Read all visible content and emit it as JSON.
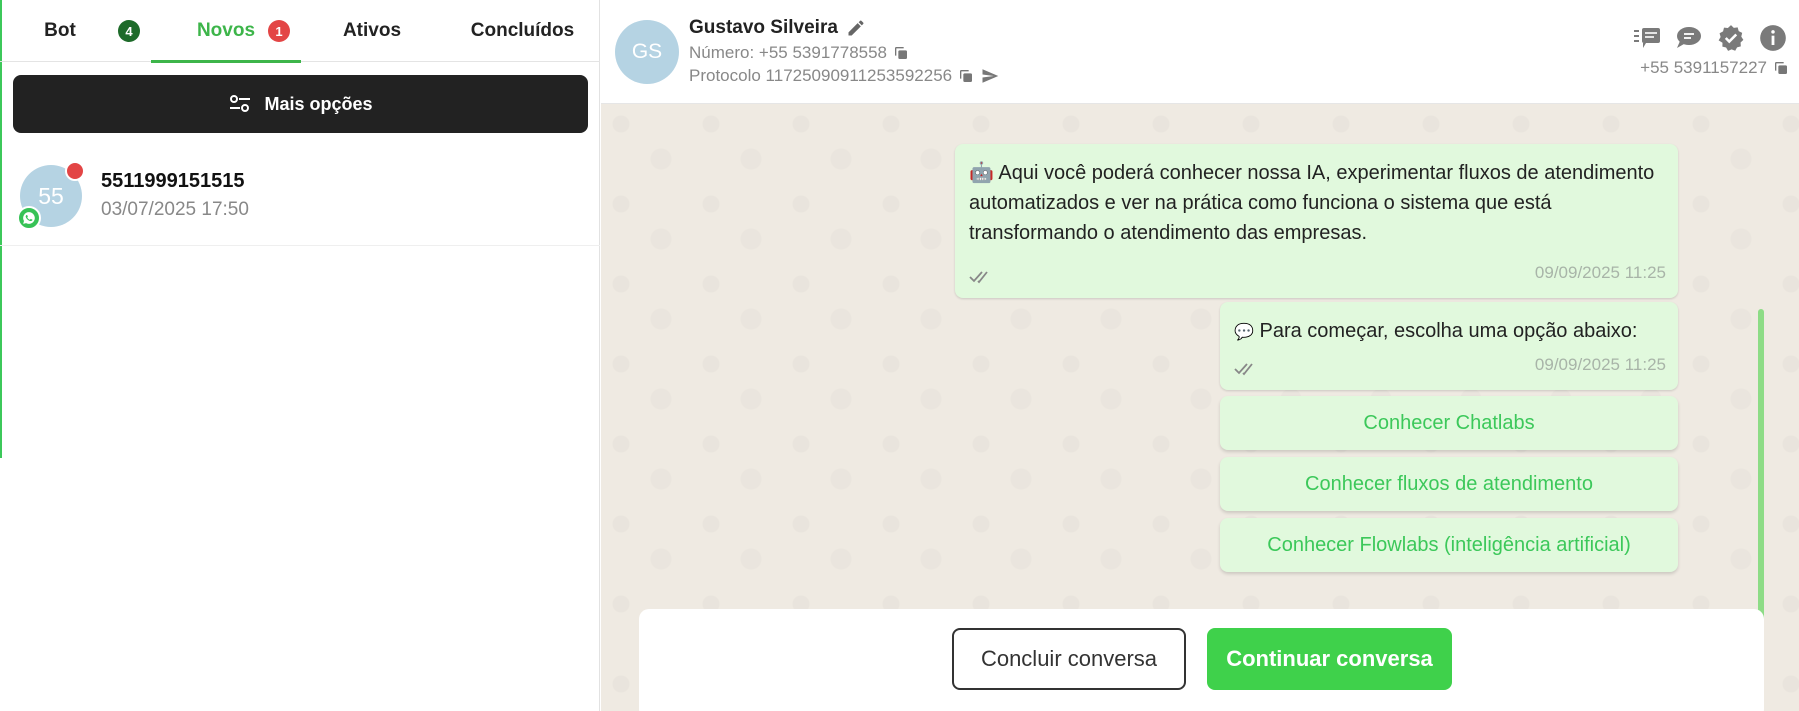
{
  "tabs": [
    {
      "label": "Bot",
      "badge": "4",
      "badge_color": "#1e6b2a"
    },
    {
      "label": "Novos",
      "badge": "1",
      "badge_color": "#e34545",
      "active": true
    },
    {
      "label": "Ativos"
    },
    {
      "label": "Concluídos"
    }
  ],
  "sidebar": {
    "more_options_label": "Mais opções",
    "contacts": [
      {
        "avatar_text": "55",
        "name": "5511999151515",
        "time": "03/07/2025 17:50"
      }
    ]
  },
  "header": {
    "avatar_text": "GS",
    "name": "Gustavo Silveira",
    "number_label": "Número: +55 5391778558",
    "protocol_label": "Protocolo 1172509091125359225​6",
    "right_phone": "+55 5391157227",
    "icons": [
      "quick-replies-icon",
      "chat-bubble-icon",
      "verified-badge-icon",
      "info-icon"
    ]
  },
  "chat": {
    "messages": [
      {
        "emoji": "🤖",
        "text": "Aqui você poderá conhecer nossa IA, experimentar fluxos de atendimento automatizados e ver na prática como funciona o sistema que está transformando o atendimento das empresas.",
        "time": "09/09/2025 11:25"
      },
      {
        "emoji": "💬",
        "text": "Para começar, escolha uma opção abaixo:",
        "time": "09/09/2025 11:25"
      }
    ],
    "options": [
      "Conhecer Chatlabs",
      "Conhecer fluxos de atendimento",
      "Conhecer Flowlabs (inteligência artificial)"
    ]
  },
  "footer": {
    "finish_label": "Concluir conversa",
    "continue_label": "Continuar conversa"
  },
  "colors": {
    "accent_green": "#3db54a",
    "bubble_bg": "#e1f9dd",
    "chat_bg": "#efeae2",
    "dark_button": "#222222",
    "continue_button": "#3fd14b",
    "unread_red": "#e34545"
  }
}
